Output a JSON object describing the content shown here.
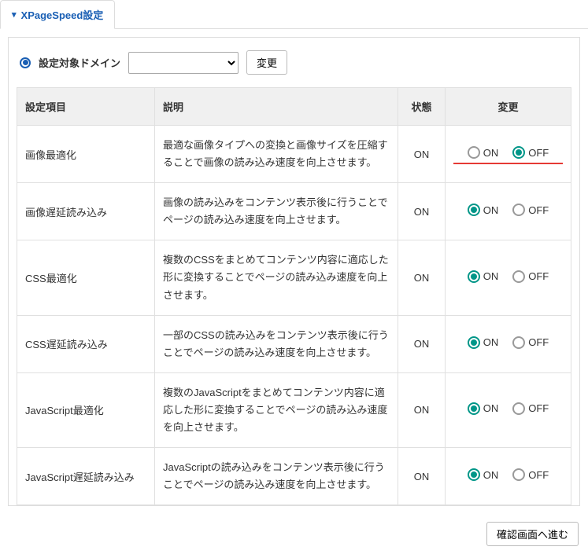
{
  "tab": {
    "label": "XPageSpeed設定"
  },
  "domain": {
    "label": "設定対象ドメイン",
    "change_btn": "変更"
  },
  "headers": {
    "item": "設定項目",
    "desc": "説明",
    "state": "状態",
    "change": "変更"
  },
  "opts": {
    "on": "ON",
    "off": "OFF"
  },
  "rows": [
    {
      "item": "画像最適化",
      "desc": "最適な画像タイプへの変換と画像サイズを圧縮することで画像の読み込み速度を向上させます。",
      "state": "ON",
      "selected": "off",
      "highlight": true
    },
    {
      "item": "画像遅延読み込み",
      "desc": "画像の読み込みをコンテンツ表示後に行うことでページの読み込み速度を向上させます。",
      "state": "ON",
      "selected": "on",
      "highlight": false
    },
    {
      "item": "CSS最適化",
      "desc": "複数のCSSをまとめてコンテンツ内容に適応した形に変換することでページの読み込み速度を向上させます。",
      "state": "ON",
      "selected": "on",
      "highlight": false
    },
    {
      "item": "CSS遅延読み込み",
      "desc": "一部のCSSの読み込みをコンテンツ表示後に行うことでページの読み込み速度を向上させます。",
      "state": "ON",
      "selected": "on",
      "highlight": false
    },
    {
      "item": "JavaScript最適化",
      "desc": "複数のJavaScriptをまとめてコンテンツ内容に適応した形に変換することでページの読み込み速度を向上させます。",
      "state": "ON",
      "selected": "on",
      "highlight": false
    },
    {
      "item": "JavaScript遅延読み込み",
      "desc": "JavaScriptの読み込みをコンテンツ表示後に行うことでページの読み込み速度を向上させます。",
      "state": "ON",
      "selected": "on",
      "highlight": false
    }
  ],
  "footer": {
    "confirm_btn": "確認画面へ進む"
  }
}
